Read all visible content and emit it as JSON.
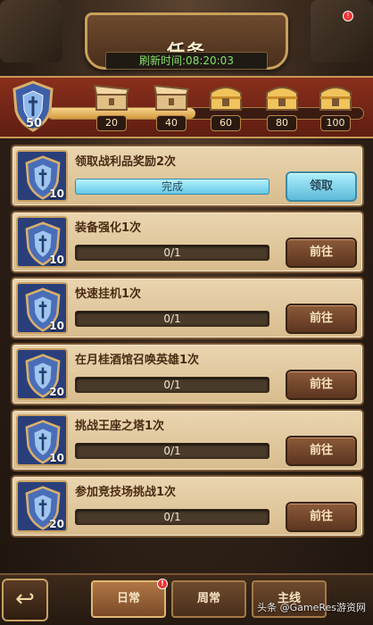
{
  "header": {
    "title": "任务",
    "refresh_text": "刷新时间:08:20:03"
  },
  "progress": {
    "current_points": "50",
    "fraction": 0.47,
    "milestones": [
      "20",
      "40",
      "60",
      "80",
      "100"
    ]
  },
  "tasks": [
    {
      "title": "领取战利品奖励2次",
      "points": "10",
      "progress": "完成",
      "button": "领取",
      "state": "claim"
    },
    {
      "title": "装备强化1次",
      "points": "10",
      "progress": "0/1",
      "button": "前往",
      "state": "goto"
    },
    {
      "title": "快速挂机1次",
      "points": "10",
      "progress": "0/1",
      "button": "前往",
      "state": "goto"
    },
    {
      "title": "在月桂酒馆召唤英雄1次",
      "points": "20",
      "progress": "0/1",
      "button": "前往",
      "state": "goto"
    },
    {
      "title": "挑战王座之塔1次",
      "points": "10",
      "progress": "0/1",
      "button": "前往",
      "state": "goto"
    },
    {
      "title": "参加竞技场挑战1次",
      "points": "20",
      "progress": "0/1",
      "button": "前往",
      "state": "goto"
    }
  ],
  "nav": {
    "back_icon": "back-arrow-icon",
    "tabs": [
      {
        "label": "日常",
        "active": true,
        "badge": "!"
      },
      {
        "label": "周常",
        "active": false
      },
      {
        "label": "主线",
        "active": false
      }
    ]
  },
  "badge_top": "!",
  "watermark": "头条 @GameRes游资网",
  "colors": {
    "accent_green": "#88e06b",
    "claim_blue": "#63c9e6",
    "button_brown": "#8b5a39"
  }
}
